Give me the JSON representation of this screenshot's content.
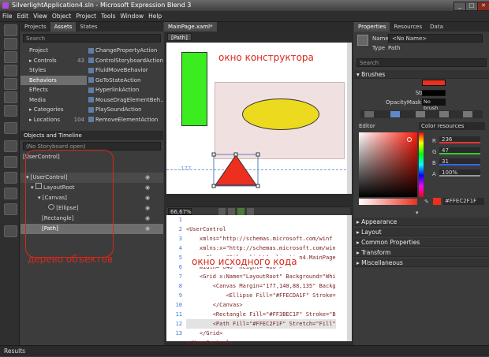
{
  "titlebar": {
    "title": "SilverlightApplication4.sln - Microsoft Expression Blend 3",
    "minimize": "_",
    "maximize": "□",
    "close": "✕"
  },
  "menu": [
    "File",
    "Edit",
    "View",
    "Object",
    "Project",
    "Tools",
    "Window",
    "Help"
  ],
  "left_tabs": [
    "Projects",
    "Assets",
    "States"
  ],
  "assets": {
    "search_placeholder": "Search",
    "categories": [
      "Project",
      "Controls",
      "Styles",
      "Behaviors",
      "Effects",
      "Media",
      "Categories",
      "Locations"
    ],
    "counts": [
      "",
      "43",
      "",
      "",
      "",
      "",
      "",
      "104"
    ],
    "selected_category": "Behaviors",
    "behaviors": [
      "ChangePropertyAction",
      "ControlStoryboardAction",
      "FluidMoveBehavior",
      "GoToStateAction",
      "HyperlinkAction",
      "MouseDragElementBeh...",
      "PlaySoundAction",
      "RemoveElementAction"
    ]
  },
  "objects": {
    "header": "Objects and Timeline",
    "storyboard": "(No Storyboard open)",
    "root": "[UserControl]",
    "tree": [
      "[UserControl]",
      "LayoutRoot",
      "[Canvas]",
      "[Ellipse]",
      "[Rectangle]",
      "[Path]"
    ]
  },
  "document": {
    "tab": "MainPage.xaml*",
    "breadcrumb": "[Path]",
    "zoom": "66,67%",
    "measure": "177"
  },
  "code_lines": [
    "<UserControl",
    "    xmlns=\"http://schemas.microsoft.com/winf",
    "    xmlns:x=\"http://schemas.microsoft.com/win",
    "    x:Class=\"SilverlightApplication4.MainPage",
    "    Width=\"640\" Height=\"480\">",
    "    <Grid x:Name=\"LayoutRoot\" Background=\"Whi",
    "        <Canvas Margin=\"177,140,88,135\" Backg",
    "            <Ellipse Fill=\"#FFECDA1F\" Stroke=",
    "        </Canvas>",
    "        <Rectangle Fill=\"#FF3BEC1F\" Stroke=\"B",
    "        <Path Fill=\"#FFEC2F1F\" Stretch=\"Fill\"",
    "    </Grid>",
    "</UserControl>"
  ],
  "annotations": {
    "designer": "окно конструктора",
    "source": "окно исходного кода",
    "tree": "дерево объектов"
  },
  "right_tabs": [
    "Properties",
    "Resources",
    "Data"
  ],
  "properties": {
    "name_label": "Name",
    "name_value": "<No Name>",
    "type_label": "Type",
    "type_value": "Path",
    "search_placeholder": "Search",
    "brushes_header": "Brushes",
    "fill_label": "Fill",
    "stroke_label": "Stroke",
    "opacity_label": "OpacityMask",
    "opacity_value": "No brush",
    "editor_label": "Editor",
    "color_resources": "Color resources",
    "R": "236",
    "G": "47",
    "B": "31",
    "A": "100%",
    "hex": "#FFEC2F1F",
    "sections": [
      "Appearance",
      "Layout",
      "Common Properties",
      "Transform",
      "Miscellaneous"
    ]
  },
  "colors": {
    "fill": "#EC2F1F",
    "ellipse": "#ECDA1F",
    "rectangle": "#3BEC1F",
    "canvas": "#F1E0E0",
    "annotation": "#D8281A"
  },
  "status": {
    "results": "Results"
  }
}
